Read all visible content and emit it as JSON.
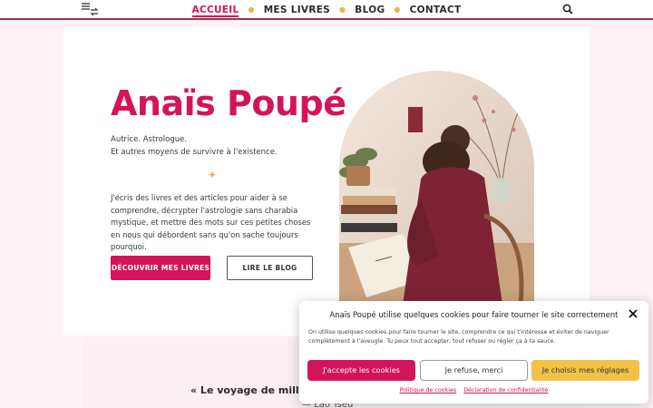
{
  "nav": {
    "items": [
      {
        "label": "ACCUEIL",
        "active": true
      },
      {
        "label": "MES LIVRES",
        "active": false
      },
      {
        "label": "BLOG",
        "active": false
      },
      {
        "label": "CONTACT",
        "active": false
      }
    ],
    "separator": "●",
    "menu_icon": "menu-shuffle-icon",
    "search_icon": "search-icon"
  },
  "hero": {
    "title": "Anaïs Poupé",
    "subtitle_line1": "Autrice. Astrologue.",
    "subtitle_line2": "Et autres moyens de survivre à l'existence.",
    "sparkle": "✦",
    "paragraph": "J'écris des livres et des articles pour aider à se comprendre, décrypter l'astrologie sans charabia mystique, et mettre des mots sur ces petites choses en nous qui débordent sans qu'on sache toujours pourquoi.",
    "primary_button": "DÉCOUVRIR MES LIVRES",
    "secondary_button": "LIRE LE BLOG",
    "photo": "woman-writing-at-desk-photo"
  },
  "quote": {
    "text": "« Le voyage de mille lieues",
    "author": "— Lao Tseu"
  },
  "cookie": {
    "title": "Anaïs Poupé utilise quelques cookies pour faire tourner le site correctement",
    "text": "On utilise quelques cookies pour faire tourner le site, comprendre ce qui t'intéresse et éviter de naviguer complètement à l'aveugle. Tu peux tout accepter, tout refuser ou régler ça à ta sauce.",
    "accept": "J'accepte les cookies",
    "refuse": "Je refuse, merci",
    "preferences": "Je choisis mes réglages",
    "link_policy": "Politique de cookies",
    "link_privacy": "Déclaration de confidentialité"
  },
  "colors": {
    "accent": "#d4145a",
    "gold": "#e8b64a",
    "nav_border": "#9b2f61",
    "page_bg": "#fdf3f6"
  }
}
